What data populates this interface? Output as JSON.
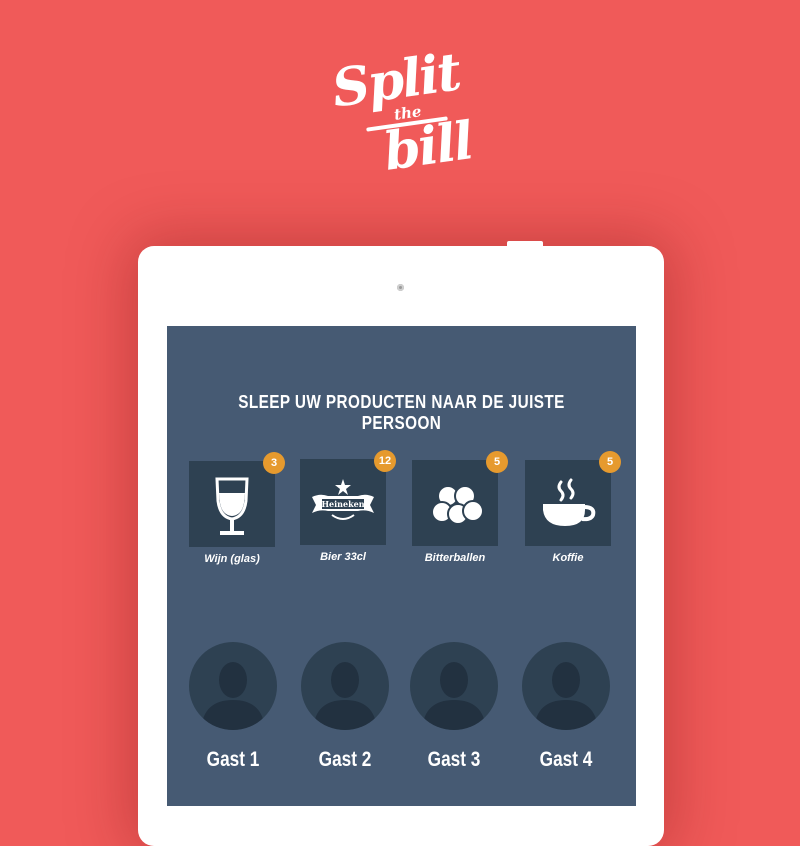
{
  "logo": {
    "line1": "Split",
    "line2": "the",
    "line3": "bill"
  },
  "screen": {
    "instruction": "SLEEP UW PRODUCTEN NAAR DE JUISTE PERSOON",
    "products": [
      {
        "label": "Wijn (glas)",
        "count": "3",
        "icon": "wine-glass-icon"
      },
      {
        "label": "Bier 33cl",
        "count": "12",
        "icon": "heineken-logo-icon"
      },
      {
        "label": "Bitterballen",
        "count": "5",
        "icon": "bitterballen-icon"
      },
      {
        "label": "Koffie",
        "count": "5",
        "icon": "coffee-cup-icon"
      }
    ],
    "guests": [
      {
        "name": "Gast 1"
      },
      {
        "name": "Gast 2"
      },
      {
        "name": "Gast 3"
      },
      {
        "name": "Gast 4"
      }
    ]
  },
  "colors": {
    "background": "#f05a59",
    "screen": "#465a73",
    "tile": "#2e4152",
    "badge": "#e69a2e"
  }
}
